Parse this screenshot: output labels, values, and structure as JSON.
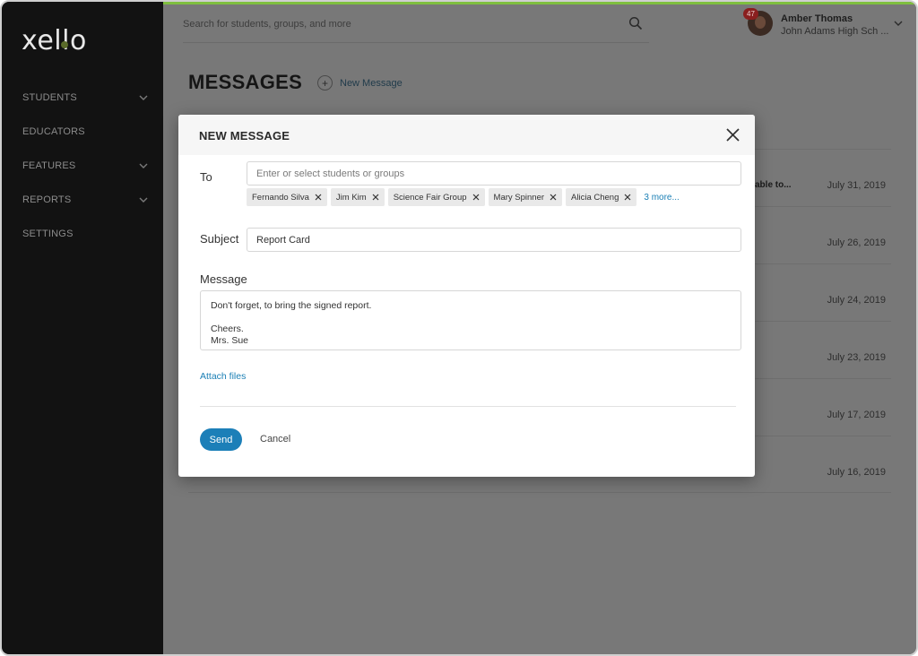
{
  "app": {
    "logo_text": "xello"
  },
  "sidebar": {
    "items": [
      {
        "label": "STUDENTS",
        "has_chevron": true
      },
      {
        "label": "EDUCATORS",
        "has_chevron": false
      },
      {
        "label": "FEATURES",
        "has_chevron": true
      },
      {
        "label": "REPORTS",
        "has_chevron": true
      },
      {
        "label": "SETTINGS",
        "has_chevron": false
      }
    ]
  },
  "header": {
    "search_placeholder": "Search for students, groups, and more",
    "notification_count": "47",
    "user_name": "Amber Thomas",
    "user_school": "John Adams High Sch ..."
  },
  "page": {
    "title": "MESSAGES",
    "new_message_label": "New Message"
  },
  "message_list": {
    "rows": [
      {
        "preview": "able to...",
        "date": "July 31, 2019"
      },
      {
        "preview": "",
        "date": "July 26, 2019"
      },
      {
        "preview": "",
        "date": "July 24, 2019"
      },
      {
        "preview": "",
        "date": "July 23, 2019"
      },
      {
        "preview": "",
        "date": "July 17, 2019"
      },
      {
        "preview": "",
        "date": "July 16, 2019"
      }
    ]
  },
  "modal": {
    "title": "NEW MESSAGE",
    "to_label": "To",
    "to_placeholder": "Enter or select students or groups",
    "recipients": [
      "Fernando Silva",
      "Jim Kim",
      "Science Fair Group",
      "Mary Spinner",
      "Alicia Cheng"
    ],
    "more_recipients": "3 more...",
    "subject_label": "Subject",
    "subject_value": "Report Card",
    "message_label": "Message",
    "message_lines": [
      "Don't forget, to bring the signed report.",
      "",
      "Cheers.",
      "Mrs. Sue"
    ],
    "attach_label": "Attach files",
    "send_label": "Send",
    "cancel_label": "Cancel"
  },
  "colors": {
    "accent": "#1c7fb8",
    "sidebar_bg": "#121212",
    "top_accent": "#7fbf3f",
    "badge": "#8a1f1f"
  }
}
